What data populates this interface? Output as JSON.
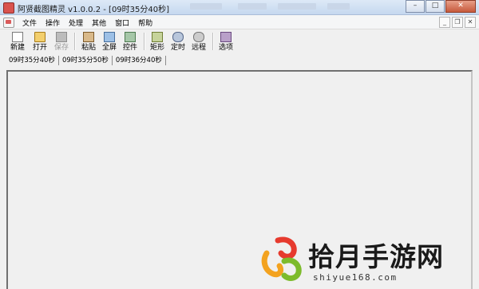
{
  "window": {
    "title": "阿贤截图精灵 v1.0.0.2 - [09时35分40秒]"
  },
  "window_controls": {
    "minimize": "–",
    "maximize": "□",
    "close": "✕"
  },
  "mdi_controls": {
    "minimize": "_",
    "restore": "❐",
    "close": "✕"
  },
  "menu": {
    "items": [
      "文件",
      "操作",
      "处理",
      "其他",
      "窗口",
      "帮助"
    ]
  },
  "toolbar": {
    "buttons": [
      {
        "label": "新建",
        "icon": "new-icon",
        "enabled": true
      },
      {
        "label": "打开",
        "icon": "open-icon",
        "enabled": true
      },
      {
        "label": "保存",
        "icon": "save-icon",
        "enabled": false
      },
      {
        "label": "粘贴",
        "icon": "paste-icon",
        "enabled": true
      },
      {
        "label": "全屏",
        "icon": "fullscreen-icon",
        "enabled": true
      },
      {
        "label": "控件",
        "icon": "control-icon",
        "enabled": true
      },
      {
        "label": "矩形",
        "icon": "rectangle-icon",
        "enabled": true
      },
      {
        "label": "定时",
        "icon": "timer-icon",
        "enabled": true
      },
      {
        "label": "远程",
        "icon": "remote-icon",
        "enabled": true
      },
      {
        "label": "选项",
        "icon": "options-icon",
        "enabled": true
      }
    ]
  },
  "tabs": [
    "09时35分40秒",
    "09时35分50秒",
    "09时36分40秒"
  ],
  "watermark": {
    "name": "拾月手游网",
    "url": "shiyue168.com"
  }
}
